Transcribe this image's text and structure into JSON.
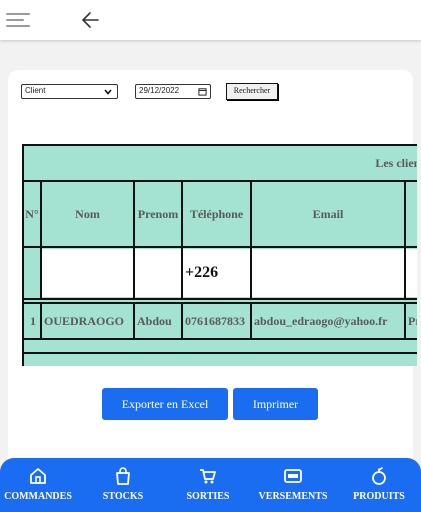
{
  "filters": {
    "select_value": "Client",
    "date_value": "29/12/2022",
    "search_label": "Rechercher"
  },
  "table": {
    "caption": "Les clients",
    "headers": [
      "N°",
      "Nom",
      "Prenom",
      "Téléphone",
      "Email",
      ""
    ],
    "phone_prefix": "+226",
    "rows": [
      [
        "1",
        "OUEDRAOGO",
        "Abdou",
        "0761687833",
        "abdou_edraogo@yahoo.fr",
        "Pro"
      ]
    ]
  },
  "actions": {
    "export_label": "Exporter en Excel",
    "print_label": "Imprimer"
  },
  "bottom_nav": {
    "items": [
      {
        "label": "COMMANDES",
        "icon": "home-icon"
      },
      {
        "label": "STOCKS",
        "icon": "shopping-bag-icon"
      },
      {
        "label": "SORTIES",
        "icon": "cart-icon"
      },
      {
        "label": "VERSEMENTS",
        "icon": "visa-card-icon"
      },
      {
        "label": "PRODUITS",
        "icon": "fruit-icon"
      }
    ]
  },
  "colors": {
    "primary": "#1a6cf0",
    "table_bg": "#a4e3d1",
    "text_gray": "#5a5a5a"
  }
}
